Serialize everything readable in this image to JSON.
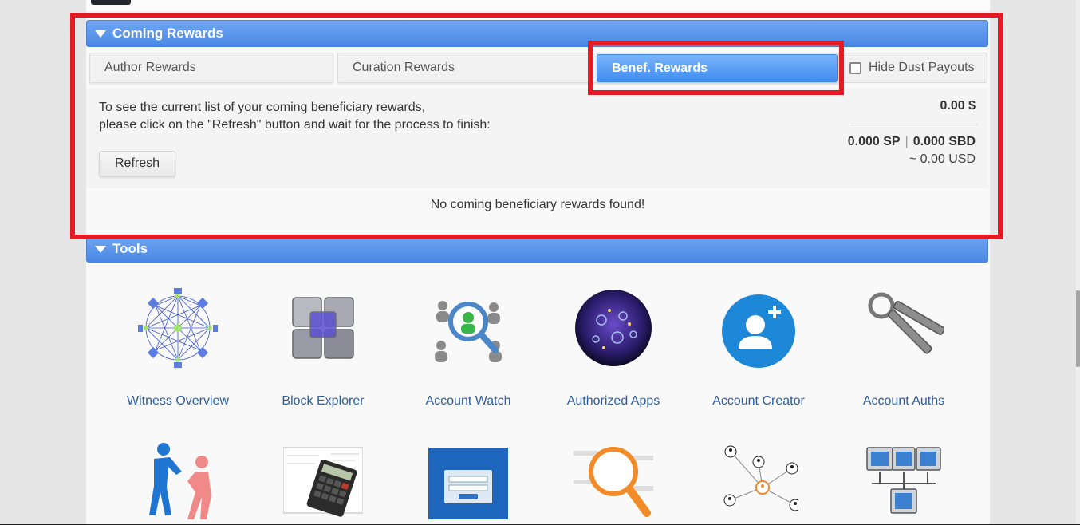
{
  "rewards_panel": {
    "title": "Coming Rewards",
    "tabs": [
      "Author Rewards",
      "Curation Rewards",
      "Benef. Rewards"
    ],
    "active_tab": "Benef. Rewards",
    "hide_dust_label": "Hide Dust Payouts",
    "hide_dust_checked": false,
    "info_line1": "To see the current list of your coming beneficiary rewards,",
    "info_line2": "please click on the \"Refresh\" button and wait for the process to finish:",
    "refresh_label": "Refresh",
    "total_value": "0.00 $",
    "sp_value": "0.000 SP",
    "sbd_value": "0.000 SBD",
    "separator": "|",
    "usd_value": "~ 0.00 USD",
    "empty_message": "No coming beneficiary rewards found!"
  },
  "tools_panel": {
    "title": "Tools",
    "items": [
      {
        "label": "Witness Overview",
        "icon": "network-icon"
      },
      {
        "label": "Block Explorer",
        "icon": "cube-icon"
      },
      {
        "label": "Account Watch",
        "icon": "magnifier-people-icon"
      },
      {
        "label": "Authorized Apps",
        "icon": "sphere-icon"
      },
      {
        "label": "Account Creator",
        "icon": "add-user-icon"
      },
      {
        "label": "Account Auths",
        "icon": "keys-icon"
      }
    ],
    "row2_icons": [
      "helping-hand-icon",
      "calculator-icon",
      "login-screen-icon",
      "search-magnifier-icon",
      "people-network-icon",
      "computer-network-icon"
    ]
  },
  "colors": {
    "header_blue": "#4b88e3",
    "active_tab_blue": "#3f8df0",
    "highlight_red": "#e21b25",
    "link_blue": "#2f5e9e"
  }
}
